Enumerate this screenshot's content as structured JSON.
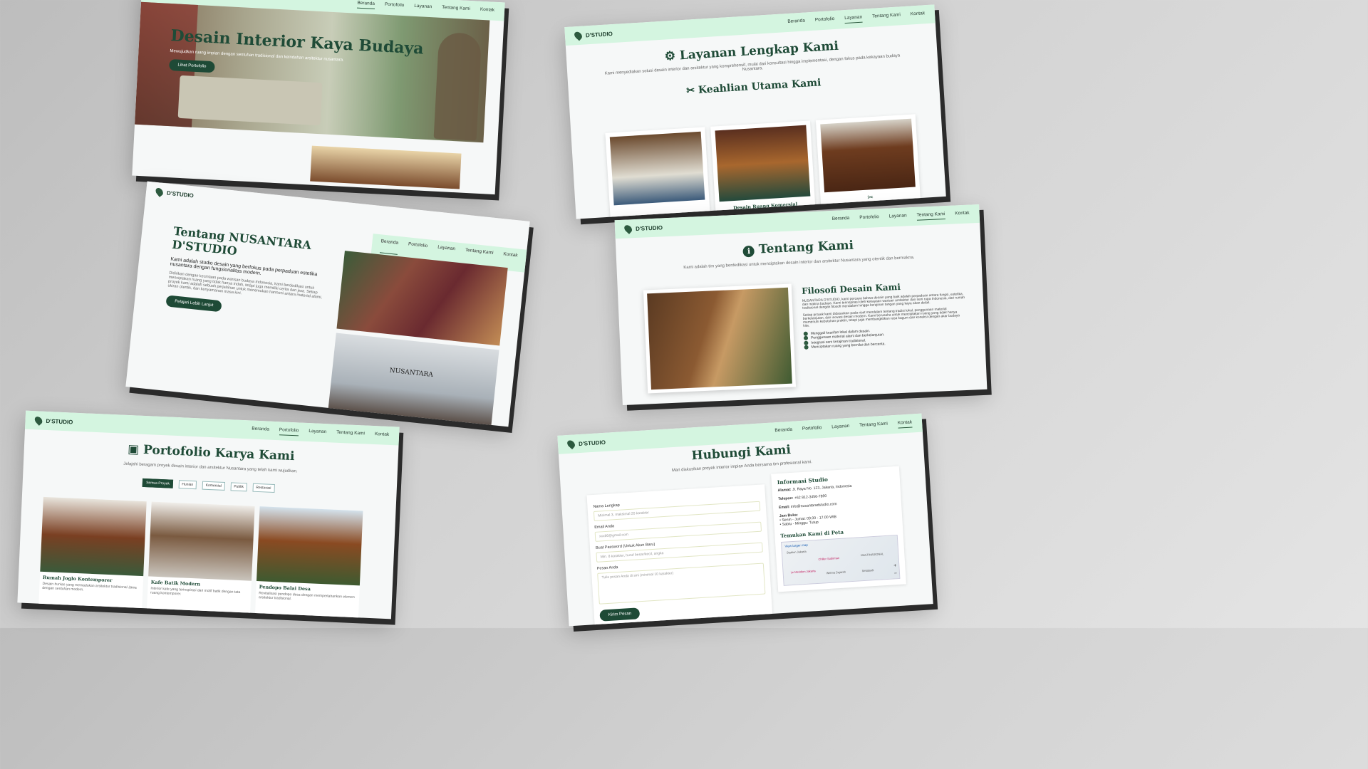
{
  "brand": "D'STUDIO",
  "nav": [
    "Beranda",
    "Portofolio",
    "Layanan",
    "Tentang Kami",
    "Kontak"
  ],
  "hero": {
    "title": "Desain Interior Kaya Budaya",
    "subtitle": "Mewujudkan ruang impian dengan sentuhan tradisional dan keindahan arsitektur nusantara.",
    "button": "Lihat Portofolio"
  },
  "services": {
    "title": "Layanan Lengkap Kami",
    "subtitle": "Kami menyediakan solusi desain interior dan arsitektur yang komprehensif, mulai dari konsultasi hingga implementasi, dengan fokus pada kekayaan budaya Nusantara.",
    "expertise_title": "Keahlian Utama Kami",
    "card_label": "Desain Ruang Komersial"
  },
  "about_left": {
    "title": "Tentang NUSANTARA D'STUDIO",
    "lead": "Kami adalah studio desain yang berfokus pada perpaduan estetika nusantara dengan fungsionalitas modern.",
    "body": "Didirikan dengan kecintaan pada warisan budaya Indonesia, kami berdedikasi untuk menciptakan ruang yang tidak hanya indah, tetapi juga memiliki cerita dan jiwa. Setiap proyek kami adalah sebuah perjalanan untuk menemukan harmoni antara material alami, ukiran otentik, dan kenyamanan masa kini.",
    "button": "Pelajari Lebih Lanjut",
    "photo_sign": "NUSANTARA"
  },
  "about_right": {
    "title": "Tentang Kami",
    "subtitle": "Kami adalah tim yang berdedikasi untuk menciptakan desain interior dan arsitektur Nusantara yang otentik dan bermakna.",
    "philosophy_title": "Filosofi Desain Kami",
    "p1": "NUSANTARA D'STUDIO, kami percaya bahwa desain yang baik adalah perpaduan antara fungsi, estetika, dan makna budaya. Kami terinspirasi oleh kekayaan warisan arsitektur dan seni rupa Indonesia, dari rumah tradisional dengan filosofi mendalam hingga kerajinan tangan yang kaya akan detail.",
    "p2": "Setiap proyek kami didasarkan pada riset mendalam tentang tradisi lokal, penggunaan material berkelanjutan, dan inovasi desain modern. Kami berusaha untuk menciptakan ruang yang tidak hanya memenuhi kebutuhan praktis, tetapi juga membangkitkan rasa kagum dan koneksi dengan akar budaya kita.",
    "checks": [
      "Menggali kearifan lokal dalam desain.",
      "Penggunaan material alami dan berkelanjutan.",
      "Integrasi seni kerajinan tradisional.",
      "Menciptakan ruang yang bernilai dan bercerita."
    ]
  },
  "portfolio": {
    "title": "Portofolio Karya Kami",
    "subtitle": "Jelajahi beragam proyek desain interior dan arsitektur Nusantara yang telah kami wujudkan.",
    "filters": [
      "Semua Proyek",
      "Hunian",
      "Komersial",
      "Publik",
      "Restorasi"
    ],
    "items": [
      {
        "title": "Rumah Joglo Kontemporer",
        "desc": "Desain hunian yang memadukan arsitektur tradisional Jawa dengan sentuhan modern."
      },
      {
        "title": "Kafe Batik Modern",
        "desc": "Interior kafe yang terinspirasi dari motif batik dengan tata ruang kontemporer."
      },
      {
        "title": "Pendopo Balai Desa",
        "desc": "Revitalisasi pendopo desa dengan mempertahankan elemen arsitektur tradisional."
      }
    ]
  },
  "contact": {
    "title": "Hubungi Kami",
    "subtitle": "Mari diskusikan proyek interior impian Anda bersama tim profesional kami.",
    "fields": [
      {
        "label": "Nama Lengkap",
        "placeholder": "Minimal 3, maksimal 20 karakter"
      },
      {
        "label": "Email Anda",
        "placeholder": "xxx86@gmail.com"
      },
      {
        "label": "Buat Password (Untuk Akun Baru)",
        "placeholder": "Min. 8 karakter, huruf besar/kecil, angka"
      },
      {
        "label": "Pesan Anda",
        "placeholder": "Tulis pesan Anda di sini (minimal 10 karakter)"
      }
    ],
    "submit": "Kirim Pesan",
    "info_title": "Informasi Studio",
    "address_label": "Alamat:",
    "address": "Jl. Raya No. 123, Jakarta, Indonesia",
    "phone_label": "Telepon:",
    "phone": "+62 812-3456-7890",
    "email_label": "Email:",
    "email": "info@nusantaradstudio.com",
    "hours_label": "Jam Buka:",
    "hours": [
      "Senin - Jumat: 09.00 - 17.00 WIB",
      "Sabtu - Minggu: Tutup"
    ],
    "map_title": "Temukan Kami di Peta",
    "map_link": "View larger map",
    "map_labels": [
      "Stadion Jakarta",
      "Chiller Sudirman",
      "Le Meridien Jakarta",
      "Wisma Sejarah",
      "MULTINASIONAL",
      "Setiabudi"
    ]
  }
}
